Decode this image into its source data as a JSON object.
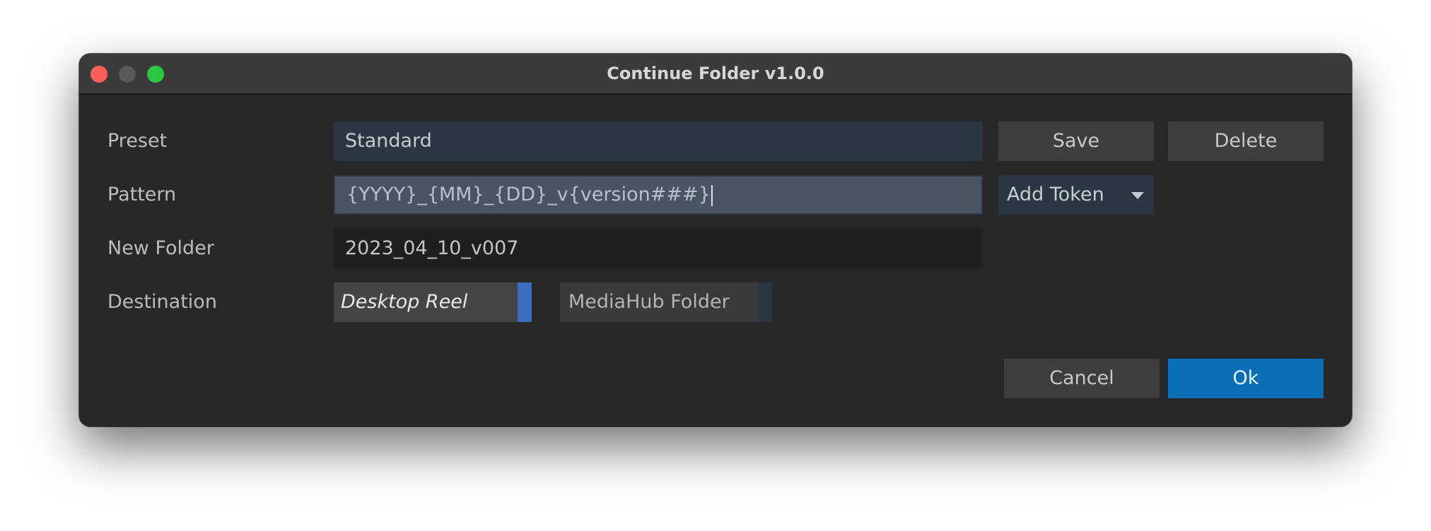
{
  "window": {
    "title": "Continue Folder v1.0.0"
  },
  "form": {
    "preset_label": "Preset",
    "preset_value": "Standard",
    "pattern_label": "Pattern",
    "pattern_value": "{YYYY}_{MM}_{DD}_v{version###}",
    "new_folder_label": "New Folder",
    "new_folder_value": "2023_04_10_v007",
    "destination_label": "Destination",
    "destination_options": [
      "Desktop Reel",
      "MediaHub Folder"
    ],
    "destination_selected": "Desktop Reel"
  },
  "buttons": {
    "save": "Save",
    "delete": "Delete",
    "add_token": "Add Token",
    "cancel": "Cancel",
    "ok": "Ok"
  },
  "colors": {
    "accent": "#0b6fb8",
    "selection_bar": "#3b6fc0"
  }
}
